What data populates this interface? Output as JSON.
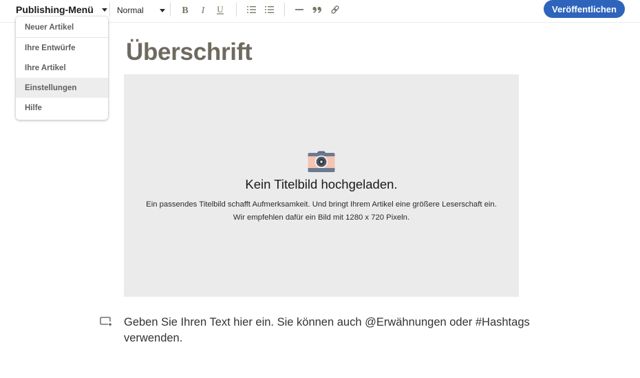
{
  "toolbar": {
    "publishing_menu_label": "Publishing-Menü",
    "text_style_value": "Normal",
    "format_buttons": [
      {
        "name": "bold",
        "icon": "bold-icon"
      },
      {
        "name": "italic",
        "icon": "italic-icon"
      },
      {
        "name": "underline",
        "icon": "underline-icon"
      },
      {
        "name": "numbered-list",
        "icon": "numbered-list-icon"
      },
      {
        "name": "bulleted-list",
        "icon": "bulleted-list-icon"
      },
      {
        "name": "divider",
        "icon": "horizontal-rule-icon"
      },
      {
        "name": "quote",
        "icon": "quote-icon"
      },
      {
        "name": "link",
        "icon": "link-icon"
      }
    ],
    "publish_label": "Veröffentlichen",
    "publish_color": "#2e64bc"
  },
  "publishing_menu": {
    "items": [
      {
        "label": "Neuer Artikel"
      },
      {
        "label": "Ihre Entwürfe"
      },
      {
        "label": "Ihre Artikel"
      },
      {
        "label": "Einstellungen",
        "highlighted": true
      },
      {
        "label": "Hilfe"
      }
    ]
  },
  "editor": {
    "headline_placeholder": "Überschrift",
    "cover": {
      "icon": "camera-icon",
      "title": "Kein Titelbild hochgeladen.",
      "description_line1": "Ein passendes Titelbild schafft Aufmerksamkeit. Und bringt Ihrem Artikel eine größere Leserschaft ein.",
      "description_line2": "Wir empfehlen dafür ein Bild mit 1280 x 720 Pixeln."
    },
    "body_placeholder": "Geben Sie Ihren Text hier ein. Sie können auch @Erwähnungen oder #Hashtags verwenden."
  }
}
